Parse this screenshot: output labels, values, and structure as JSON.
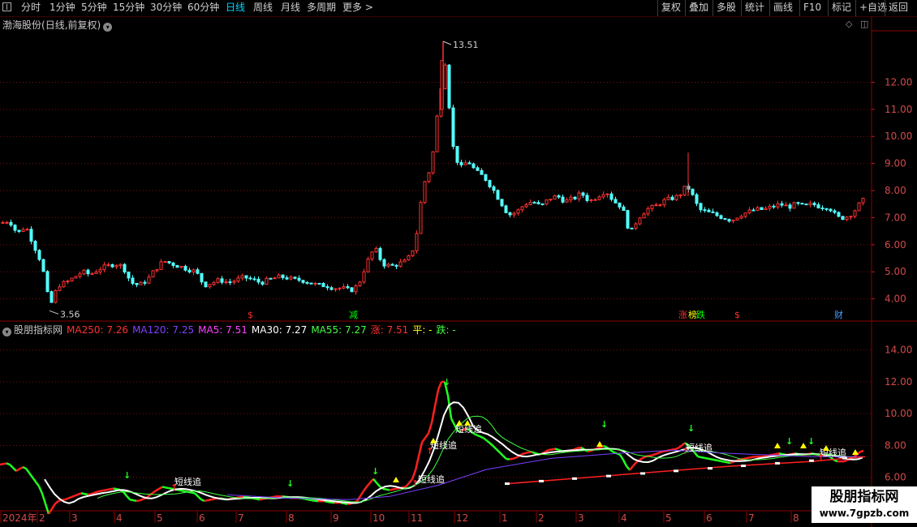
{
  "toolbar": {
    "periods": [
      {
        "label": "分时",
        "active": false
      },
      {
        "label": "1分钟",
        "active": false
      },
      {
        "label": "5分钟",
        "active": false
      },
      {
        "label": "15分钟",
        "active": false
      },
      {
        "label": "30分钟",
        "active": false
      },
      {
        "label": "60分钟",
        "active": false
      },
      {
        "label": "日线",
        "active": true
      },
      {
        "label": "周线",
        "active": false
      },
      {
        "label": "月线",
        "active": false
      },
      {
        "label": "多周期",
        "active": false
      },
      {
        "label": "更多 >",
        "active": false
      }
    ],
    "actions": [
      "复权",
      "叠加",
      "多股",
      "统计",
      "画线",
      "F10",
      "标记",
      "+自选",
      "返回"
    ]
  },
  "main_chart": {
    "stock_name": "渤海股份",
    "mode": "(日线,前复权)",
    "high_label": "13.51",
    "low_label": "3.56",
    "y_ticks": [
      "12.00",
      "11.00",
      "10.00",
      "9.00",
      "8.00",
      "7.00",
      "6.00",
      "5.00",
      "4.00"
    ],
    "events": [
      {
        "text": "$",
        "color": "#ff3030"
      },
      {
        "text": "减",
        "color": "#00ff00"
      },
      {
        "text": "涨",
        "color": "#ff3030"
      },
      {
        "text": "榜",
        "color": "#ffff00"
      },
      {
        "text": "跌",
        "color": "#00ff00"
      },
      {
        "text": "$",
        "color": "#ff3030"
      },
      {
        "text": "财",
        "color": "#4aa0ff"
      }
    ]
  },
  "indicator": {
    "name": "股朋指标网",
    "items": [
      {
        "label": "MA250: 7.26",
        "color": "#ff3030"
      },
      {
        "label": "MA120: 7.25",
        "color": "#8040ff"
      },
      {
        "label": "MA5: 7.51",
        "color": "#ff40ff"
      },
      {
        "label": "MA30: 7.27",
        "color": "#ffffff"
      },
      {
        "label": "MA55: 7.27",
        "color": "#40ff40"
      },
      {
        "label": "涨: 7.51",
        "color": "#ff3030"
      },
      {
        "label": "平: -",
        "color": "#ffff00"
      },
      {
        "label": "跌: -",
        "color": "#40ff40"
      }
    ],
    "y_ticks": [
      "14.00",
      "12.00",
      "10.00",
      "8.00",
      "6.00"
    ],
    "signal_label": "短线追"
  },
  "date_axis": [
    "2024年",
    "2",
    "3",
    "4",
    "5",
    "6",
    "7",
    "8",
    "9",
    "10",
    "11",
    "12",
    "1",
    "2",
    "3",
    "4",
    "5",
    "6",
    "7",
    "8"
  ],
  "watermark": {
    "line1": "股朋指标网",
    "line2": "www.7gpzb.com"
  },
  "chart_data": {
    "type": "candlestick",
    "price_range": [
      3.3,
      13.9
    ],
    "indicator_range": [
      4.0,
      15.0
    ],
    "price_path": [
      [
        0,
        6.8
      ],
      [
        10,
        6.9
      ],
      [
        20,
        6.4
      ],
      [
        30,
        6.7
      ],
      [
        40,
        6.0
      ],
      [
        50,
        5.3
      ],
      [
        60,
        3.7
      ],
      [
        70,
        4.5
      ],
      [
        80,
        4.6
      ],
      [
        90,
        4.8
      ],
      [
        100,
        5.0
      ],
      [
        110,
        4.9
      ],
      [
        120,
        5.1
      ],
      [
        130,
        5.2
      ],
      [
        140,
        5.3
      ],
      [
        150,
        5.2
      ],
      [
        160,
        4.6
      ],
      [
        170,
        4.5
      ],
      [
        180,
        4.7
      ],
      [
        190,
        5.1
      ],
      [
        200,
        5.4
      ],
      [
        210,
        5.3
      ],
      [
        220,
        5.2
      ],
      [
        230,
        5.1
      ],
      [
        240,
        5.0
      ],
      [
        250,
        4.5
      ],
      [
        260,
        4.6
      ],
      [
        270,
        4.7
      ],
      [
        280,
        4.6
      ],
      [
        290,
        4.7
      ],
      [
        300,
        4.8
      ],
      [
        310,
        4.7
      ],
      [
        320,
        4.6
      ],
      [
        330,
        4.7
      ],
      [
        340,
        4.8
      ],
      [
        350,
        4.8
      ],
      [
        360,
        4.7
      ],
      [
        370,
        4.7
      ],
      [
        380,
        4.6
      ],
      [
        390,
        4.5
      ],
      [
        400,
        4.5
      ],
      [
        410,
        4.4
      ],
      [
        420,
        4.4
      ],
      [
        430,
        4.3
      ],
      [
        440,
        4.5
      ],
      [
        450,
        5.3
      ],
      [
        460,
        5.9
      ],
      [
        470,
        5.3
      ],
      [
        480,
        5.2
      ],
      [
        490,
        5.3
      ],
      [
        500,
        5.4
      ],
      [
        510,
        6.0
      ],
      [
        520,
        8.2
      ],
      [
        530,
        8.9
      ],
      [
        540,
        11.5
      ],
      [
        548,
        12.9
      ],
      [
        555,
        9.8
      ],
      [
        565,
        8.8
      ],
      [
        575,
        9.1
      ],
      [
        585,
        8.7
      ],
      [
        595,
        8.5
      ],
      [
        605,
        8.1
      ],
      [
        615,
        7.6
      ],
      [
        625,
        7.1
      ],
      [
        635,
        7.2
      ],
      [
        645,
        7.5
      ],
      [
        655,
        7.6
      ],
      [
        665,
        7.4
      ],
      [
        675,
        7.7
      ],
      [
        685,
        7.8
      ],
      [
        695,
        7.6
      ],
      [
        705,
        7.7
      ],
      [
        715,
        7.9
      ],
      [
        725,
        7.6
      ],
      [
        735,
        7.8
      ],
      [
        745,
        8.0
      ],
      [
        755,
        7.6
      ],
      [
        765,
        7.4
      ],
      [
        775,
        6.4
      ],
      [
        785,
        7.0
      ],
      [
        795,
        7.3
      ],
      [
        805,
        7.4
      ],
      [
        815,
        7.6
      ],
      [
        825,
        7.7
      ],
      [
        835,
        7.8
      ],
      [
        845,
        8.2
      ],
      [
        852,
        7.8
      ],
      [
        860,
        7.3
      ],
      [
        870,
        7.2
      ],
      [
        880,
        7.1
      ],
      [
        890,
        7.0
      ],
      [
        900,
        6.9
      ],
      [
        910,
        7.1
      ],
      [
        920,
        7.2
      ],
      [
        930,
        7.3
      ],
      [
        940,
        7.3
      ],
      [
        950,
        7.4
      ],
      [
        960,
        7.5
      ],
      [
        970,
        7.4
      ],
      [
        980,
        7.5
      ],
      [
        990,
        7.4
      ],
      [
        1000,
        7.5
      ],
      [
        1010,
        7.4
      ],
      [
        1020,
        7.4
      ],
      [
        1030,
        7.0
      ],
      [
        1040,
        7.0
      ],
      [
        1050,
        7.2
      ],
      [
        1060,
        7.6
      ],
      [
        1066,
        7.7
      ]
    ],
    "ma250": [
      [
        625,
        5.6
      ],
      [
        700,
        5.9
      ],
      [
        800,
        6.3
      ],
      [
        900,
        6.7
      ],
      [
        1000,
        7.0
      ],
      [
        1066,
        7.3
      ]
    ],
    "ma120": [
      [
        280,
        4.9
      ],
      [
        350,
        4.7
      ],
      [
        430,
        4.6
      ],
      [
        480,
        4.8
      ],
      [
        540,
        5.5
      ],
      [
        600,
        6.5
      ],
      [
        680,
        7.2
      ],
      [
        760,
        7.5
      ],
      [
        830,
        7.7
      ],
      [
        900,
        7.5
      ],
      [
        1000,
        7.3
      ],
      [
        1066,
        7.3
      ]
    ]
  }
}
